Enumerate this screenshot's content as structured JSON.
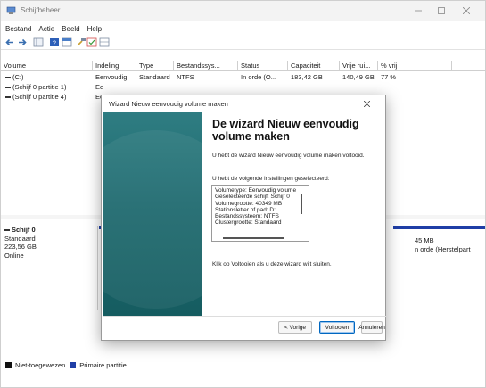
{
  "window": {
    "title": "Schijfbeheer"
  },
  "menu": [
    "Bestand",
    "Actie",
    "Beeld",
    "Help"
  ],
  "volumes": {
    "headers": [
      "Volume",
      "Indeling",
      "Type",
      "Bestandssys...",
      "Status",
      "Capaciteit",
      "Vrije rui...",
      "% vrij"
    ],
    "rows": [
      [
        "(C:)",
        "Eenvoudig",
        "Standaard",
        "NTFS",
        "In orde (O...",
        "183,42 GB",
        "140,49 GB",
        "77 %"
      ],
      [
        "(Schijf 0 partitie 1)",
        "Ee",
        "",
        "",
        "",
        "",
        "",
        ""
      ],
      [
        "(Schijf 0 partitie 4)",
        "Ee",
        "",
        "",
        "",
        "",
        "",
        ""
      ]
    ]
  },
  "disk": {
    "name": "Schijf 0",
    "type": "Standaard",
    "size": "223,56 GB",
    "status": "Online",
    "right_size": "45 MB",
    "right_status": "n orde (Herstelpart"
  },
  "legend": [
    {
      "label": "Niet-toegewezen",
      "color": "#111111"
    },
    {
      "label": "Primaire partitie",
      "color": "#1f3ea6"
    }
  ],
  "dialog": {
    "title": "Wizard Nieuw eenvoudig volume maken",
    "heading": "De wizard Nieuw eenvoudig volume maken",
    "completed_text": "U hebt de wizard Nieuw eenvoudig volume maken voltooid.",
    "settings_label": "U hebt de volgende instellingen geselecteerd:",
    "settings": [
      "Volumetype: Eenvoudig volume",
      "Geselecteerde schijf: Schijf 0",
      "Volumegrootte: 40349 MB",
      "Stationsletter of pad: D:",
      "Bestandssysteem: NTFS",
      "Clustergrootte: Standaard"
    ],
    "close_text": "Klik op Voltooien als u deze wizard wilt sluiten.",
    "btn_back": "< Vorige",
    "btn_finish": "Voltooien",
    "btn_cancel": "Annuleren"
  }
}
